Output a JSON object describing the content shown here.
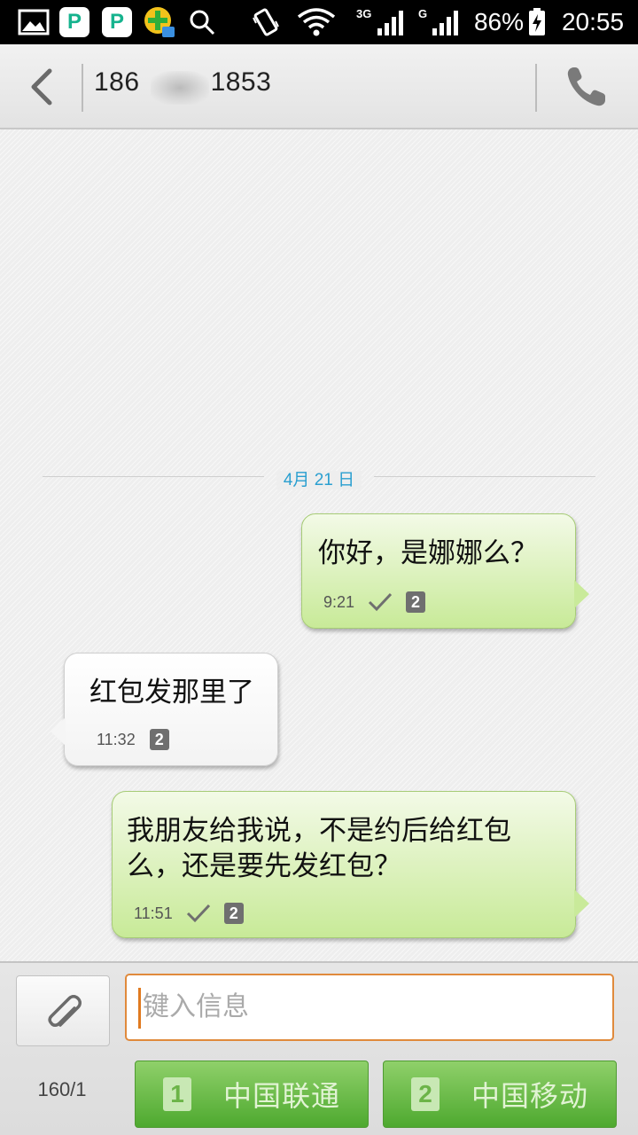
{
  "status_bar": {
    "network_3g": "3G",
    "network_g": "G",
    "battery": "86%",
    "time": "20:55"
  },
  "header": {
    "contact_prefix": "186",
    "contact_suffix": "1853"
  },
  "conversation": {
    "date": "4月 21 日",
    "messages": [
      {
        "direction": "outgoing",
        "text": "你好，是娜娜么？",
        "time": "9:21",
        "sim": "2",
        "delivered": true
      },
      {
        "direction": "incoming",
        "text": "红包发那里了",
        "time": "11:32",
        "sim": "2"
      },
      {
        "direction": "outgoing",
        "text_line1": "我朋友给我说，不是约后给红包",
        "text_line2": "么，还是要先发红包？",
        "time": "11:51",
        "sim": "2",
        "delivered": true
      }
    ]
  },
  "composer": {
    "placeholder": "键入信息",
    "char_count": "160/1",
    "send_sim1": {
      "sim": "1",
      "carrier": "中国联通"
    },
    "send_sim2": {
      "sim": "2",
      "carrier": "中国移动"
    }
  },
  "colors": {
    "outgoing_bubble": "#c8ea98",
    "incoming_bubble": "#ffffff",
    "send_button": "#4ea92f",
    "date_text": "#2a9fd0",
    "input_border": "#e08a3c"
  }
}
